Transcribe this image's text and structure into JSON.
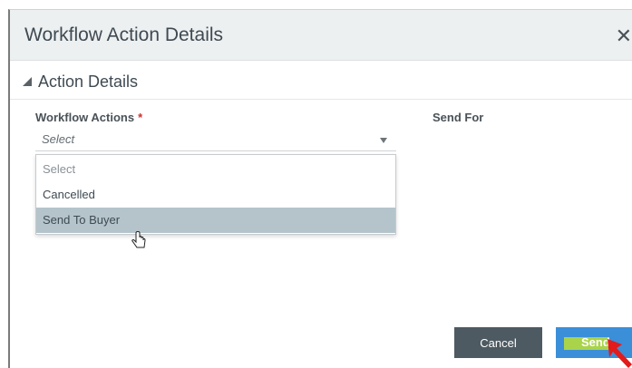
{
  "dialog": {
    "title": "Workflow Action Details",
    "close_icon": "close-icon"
  },
  "section": {
    "title": "Action Details",
    "collapse_icon": "collapse-triangle-icon"
  },
  "fields": {
    "workflow_actions_label": "Workflow Actions",
    "required_marker": "*",
    "send_for_label": "Send For",
    "select_value": "Select"
  },
  "dropdown": {
    "options": [
      "Select",
      "Cancelled",
      "Send To Buyer"
    ],
    "hovered_option": "Send To Buyer"
  },
  "buttons": {
    "cancel": "Cancel",
    "send": "Send"
  },
  "colors": {
    "header_bg": "#edf0f1",
    "hover_bg": "#b5c4cb",
    "cancel_bg": "#4e5a61",
    "send_bg": "#3b8fd8",
    "highlight": "#a9d34b",
    "arrow": "#e21b1b"
  }
}
